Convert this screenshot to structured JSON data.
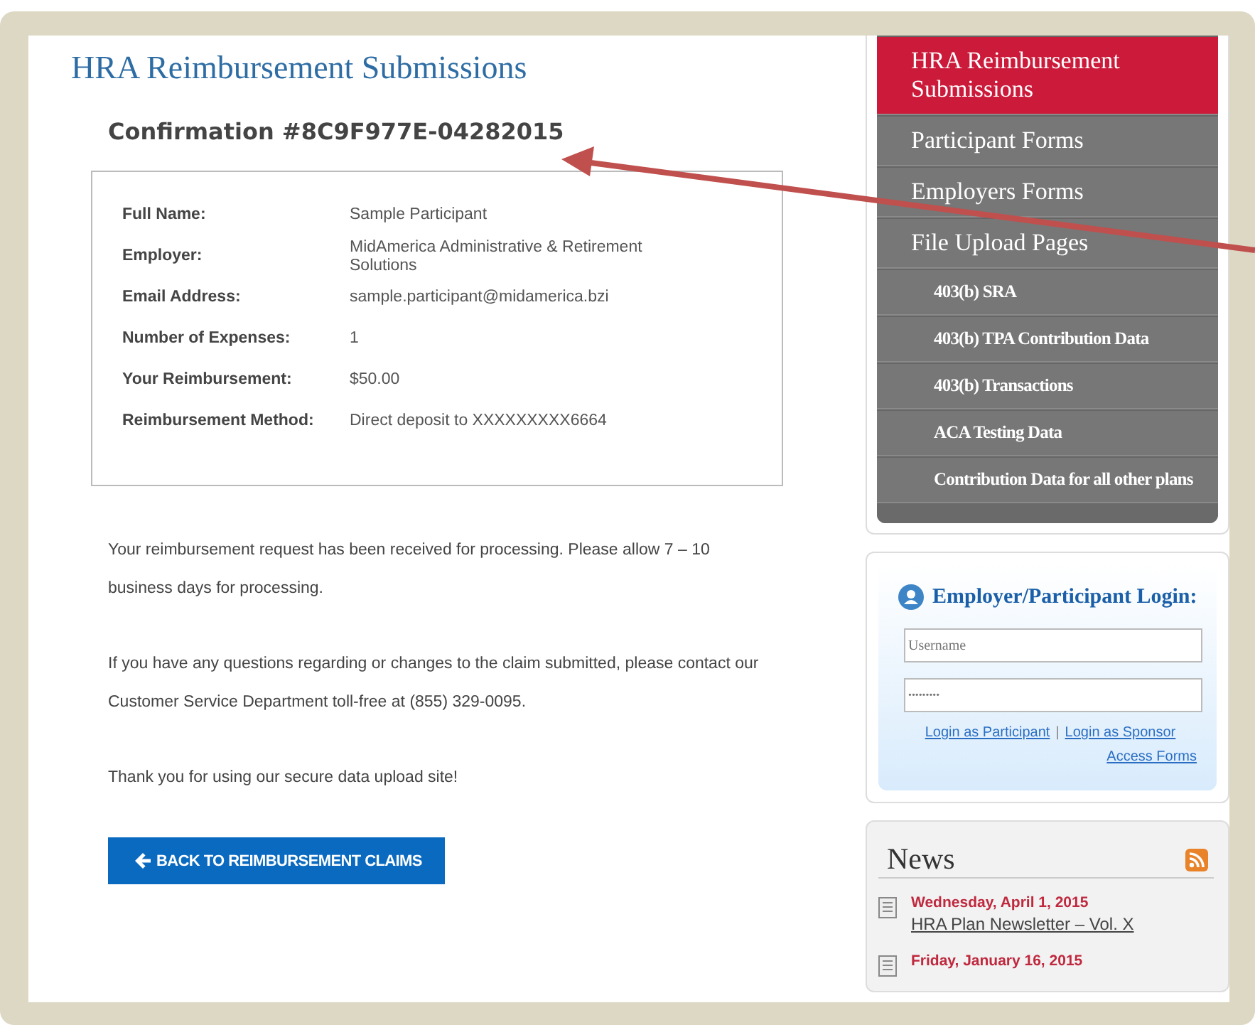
{
  "page_title": "HRA Reimbursement Submissions",
  "confirmation": "Confirmation #8C9F977E-04282015",
  "details": [
    {
      "label": "Full Name:",
      "value": "Sample Participant"
    },
    {
      "label": "Employer:",
      "value": "MidAmerica Administrative & Retirement Solutions"
    },
    {
      "label": "Email Address:",
      "value": "sample.participant@midamerica.bzi"
    },
    {
      "label": "Number of Expenses:",
      "value": "1"
    },
    {
      "label": "Your Reimbursement:",
      "value": "$50.00"
    },
    {
      "label": "Reimbursement Method:",
      "value": "Direct deposit to XXXXXXXXX6664"
    }
  ],
  "messages": [
    "Your reimbursement request has been received for processing. Please allow 7 – 10 business days for processing.",
    "If you have any questions regarding or changes to the claim submitted, please contact our Customer Service Department toll-free at (855) 329-0095.",
    "Thank you for using our secure data upload site!"
  ],
  "back_button": "BACK TO REIMBURSEMENT CLAIMS",
  "nav": [
    {
      "label": "HRA Reimbursement Submissions",
      "kind": "main",
      "selected": true
    },
    {
      "label": "Participant Forms",
      "kind": "main",
      "selected": false
    },
    {
      "label": "Employers Forms",
      "kind": "main",
      "selected": false
    },
    {
      "label": "File Upload Pages",
      "kind": "main",
      "selected": false
    },
    {
      "label": "403(b) SRA",
      "kind": "sub",
      "selected": false
    },
    {
      "label": "403(b) TPA Contribution Data",
      "kind": "sub",
      "selected": false
    },
    {
      "label": "403(b) Transactions",
      "kind": "sub",
      "selected": false
    },
    {
      "label": "ACA Testing Data",
      "kind": "sub",
      "selected": false
    },
    {
      "label": "Contribution Data for all other plans",
      "kind": "sub",
      "selected": false
    }
  ],
  "login": {
    "title": "Employer/Participant Login:",
    "username": {
      "placeholder": "Username"
    },
    "password": {
      "value": "•••••••••"
    },
    "links": [
      "Login as Participant",
      "Login as Sponsor"
    ],
    "separator": "|",
    "access_link": "Access Forms"
  },
  "news": {
    "title": "News",
    "items": [
      {
        "date": "Wednesday, April 1, 2015",
        "title": "HRA Plan Newsletter – Vol. X"
      },
      {
        "date": "Friday, January 16, 2015"
      }
    ]
  }
}
